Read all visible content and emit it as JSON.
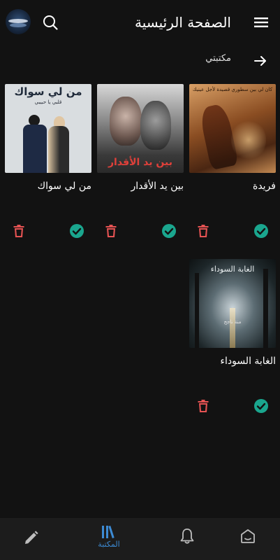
{
  "header": {
    "title": "الصفحة الرئيسية",
    "menu_icon": "hamburger-menu-icon",
    "search_icon": "search-icon",
    "avatar": "app-logo"
  },
  "section": {
    "title": "مكتبتي",
    "back_icon": "arrow-right-icon"
  },
  "books": [
    {
      "title": "فريدة",
      "cover_text": "كان لي بين سطوري قصيدة لأجل عينيك",
      "delete_icon": "trash-icon",
      "done_icon": "check-circle-icon"
    },
    {
      "title": "بين يد الأقدار",
      "cover_text": "بين يد الأقدار",
      "delete_icon": "trash-icon",
      "done_icon": "check-circle-icon"
    },
    {
      "title": "من لي سواك",
      "cover_text": "من لي سواك",
      "cover_subtext": "قلبي يا حبيبي",
      "delete_icon": "trash-icon",
      "done_icon": "check-circle-icon"
    },
    {
      "title": "الغابة السوداء",
      "cover_text": "الغابة السوداء",
      "cover_subtext": "منة ناجح",
      "delete_icon": "trash-icon",
      "done_icon": "check-circle-icon"
    }
  ],
  "bottom_nav": {
    "items": [
      {
        "icon": "pencil-icon",
        "label": ""
      },
      {
        "icon": "library-icon",
        "label": "المكتبة",
        "active": true
      },
      {
        "icon": "bell-icon",
        "label": ""
      },
      {
        "icon": "home-icon",
        "label": ""
      }
    ]
  },
  "colors": {
    "background": "#121212",
    "accent": "#3d8bd4",
    "delete": "#e55353",
    "done": "#1aa68e",
    "nav_bg": "#1c1c1c"
  }
}
